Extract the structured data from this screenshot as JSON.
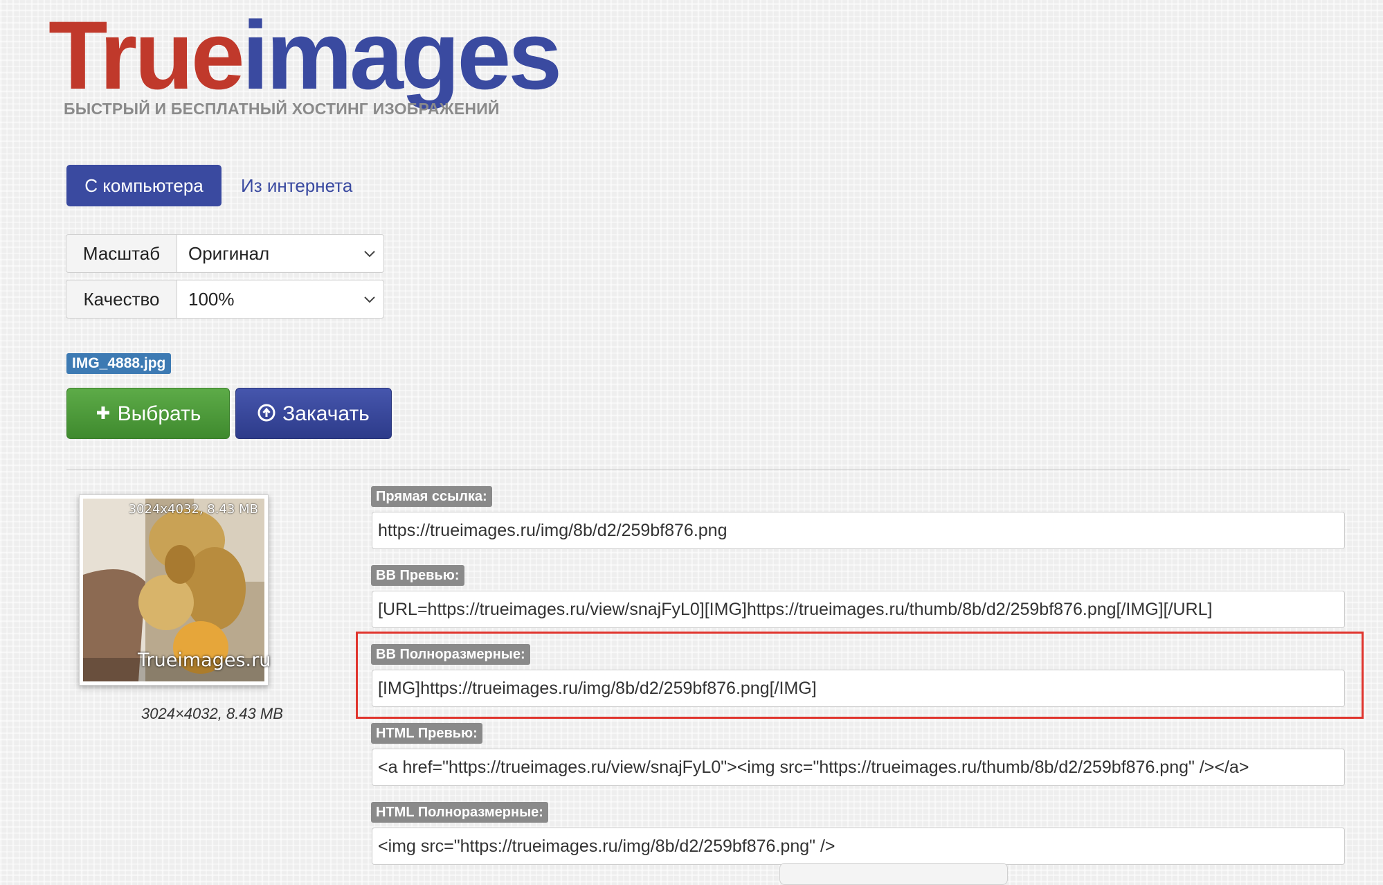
{
  "logo": {
    "part1": "True",
    "part2": "images",
    "tagline": "БЫСТРЫЙ И БЕСПЛАТНЫЙ ХОСТИНГ ИЗОБРАЖЕНИЙ"
  },
  "tabs": {
    "computer": "С компьютера",
    "internet": "Из интернета"
  },
  "settings": {
    "scale_label": "Масштаб",
    "scale_value": "Оригинал",
    "quality_label": "Качество",
    "quality_value": "100%"
  },
  "file": {
    "name": "IMG_4888.jpg"
  },
  "buttons": {
    "select": "Выбрать",
    "upload": "Закачать"
  },
  "thumbnail": {
    "size_overlay": "3024x4032, 8.43 MB",
    "brand": "Trueimages.ru",
    "caption": "3024×4032, 8.43 MB"
  },
  "codes": [
    {
      "label": "Прямая ссылка:",
      "value": "https://trueimages.ru/img/8b/d2/259bf876.png"
    },
    {
      "label": "BB Превью:",
      "value": "[URL=https://trueimages.ru/view/snajFyL0][IMG]https://trueimages.ru/thumb/8b/d2/259bf876.png[/IMG][/URL]"
    },
    {
      "label": "BB Полноразмерные:",
      "value": "[IMG]https://trueimages.ru/img/8b/d2/259bf876.png[/IMG]"
    },
    {
      "label": "HTML Превью:",
      "value": "<a href=\"https://trueimages.ru/view/snajFyL0\"><img src=\"https://trueimages.ru/thumb/8b/d2/259bf876.png\" /></a>"
    },
    {
      "label": "HTML Полноразмерные:",
      "value": "<img src=\"https://trueimages.ru/img/8b/d2/259bf876.png\" />"
    }
  ],
  "colors": {
    "accent": "#3a4aa0",
    "logo_red": "#c0392b",
    "success": "#4e9a3b",
    "highlight": "#e0342d"
  }
}
